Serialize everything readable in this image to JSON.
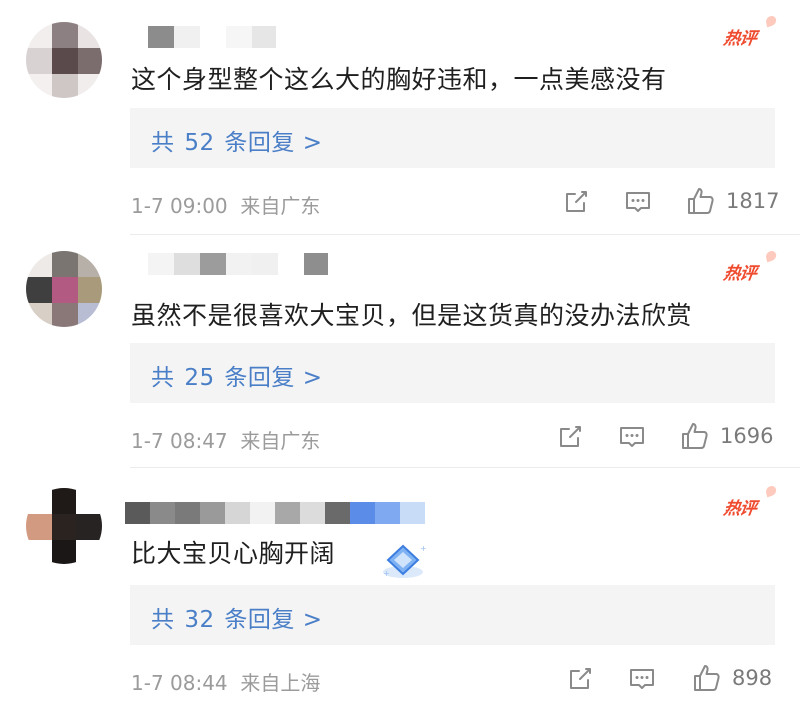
{
  "hot_label": "热评",
  "comments": [
    {
      "text": "这个身型整个这么大的胸好违和，一点美感没有",
      "replies_prefix": "共",
      "replies_count": "52",
      "replies_suffix": "条回复 >",
      "time": "1-7 09:00",
      "location": "来自广东",
      "likes": "1817"
    },
    {
      "text": "虽然不是很喜欢大宝贝，但是这货真的没办法欣赏",
      "replies_prefix": "共",
      "replies_count": "25",
      "replies_suffix": "条回复 >",
      "time": "1-7 08:47",
      "location": "来自广东",
      "likes": "1696"
    },
    {
      "text": "比大宝贝心胸开阔",
      "replies_prefix": "共",
      "replies_count": "32",
      "replies_suffix": "条回复 >",
      "time": "1-7 08:44",
      "location": "来自上海",
      "likes": "898"
    }
  ],
  "icons": {
    "share": "share-icon",
    "comment": "comment-icon",
    "like": "thumbs-up-icon",
    "sticker": "diamond-sticker-icon"
  },
  "colors": {
    "hot": "#ef4b2f",
    "reply_link": "#4a7fc7",
    "meta": "#9b9b9b",
    "text": "#1f1f1f"
  }
}
